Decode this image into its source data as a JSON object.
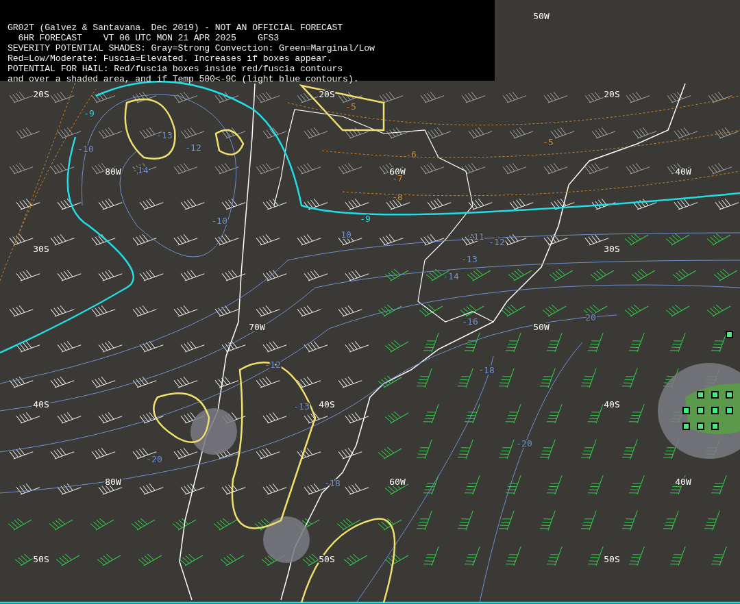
{
  "header": {
    "lines": [
      "GR02T (Galvez & Santavana. Dec 2019) - NOT AN OFFICIAL FORECAST",
      "  6HR FORECAST    VT 06 UTC MON 21 APR 2025    GFS3",
      "SEVERITY POTENTIAL SHADES: Gray=Strong Convection: Green=Marginal/Low",
      "Red=Low/Moderate: Fuscia=Elevated. Increases if boxes appear.",
      "POTENTIAL FOR HAIL: Red/fuscia boxes inside red/fuscia contours",
      "and over a shaded area, and if Temp 500<-9C (light blue contours)."
    ]
  },
  "map": {
    "grid_labels": [
      "50W",
      "20S",
      "20S",
      "20S",
      "80W",
      "60W",
      "40W",
      "30S",
      "30S",
      "70W",
      "50W",
      "40S",
      "40S",
      "40S",
      "80W",
      "60W",
      "40W",
      "50S",
      "50S",
      "50S"
    ],
    "contour_labels": [
      {
        "text": "-9",
        "kind": "threshold"
      },
      {
        "text": "-13",
        "kind": "temperature"
      },
      {
        "text": "-10",
        "kind": "temperature"
      },
      {
        "text": "-12",
        "kind": "temperature"
      },
      {
        "text": "-14",
        "kind": "temperature"
      },
      {
        "text": "-10",
        "kind": "temperature"
      },
      {
        "text": "-9",
        "kind": "threshold"
      },
      {
        "text": "10",
        "kind": "temperature"
      },
      {
        "text": "-11",
        "kind": "temperature"
      },
      {
        "text": "-12",
        "kind": "temperature"
      },
      {
        "text": "-13",
        "kind": "temperature"
      },
      {
        "text": "-14",
        "kind": "temperature"
      },
      {
        "text": "-16",
        "kind": "temperature"
      },
      {
        "text": "20",
        "kind": "temperature"
      },
      {
        "text": "-18",
        "kind": "temperature"
      },
      {
        "text": "-12",
        "kind": "temperature"
      },
      {
        "text": "-13",
        "kind": "temperature"
      },
      {
        "text": "-20",
        "kind": "temperature"
      },
      {
        "text": "-18",
        "kind": "temperature"
      },
      {
        "text": "-20",
        "kind": "temperature"
      },
      {
        "text": "-5",
        "kind": "thickness"
      },
      {
        "text": "-5",
        "kind": "thickness"
      },
      {
        "text": "-6",
        "kind": "thickness"
      },
      {
        "text": "-7",
        "kind": "thickness"
      },
      {
        "text": "-8",
        "kind": "thickness"
      }
    ]
  }
}
